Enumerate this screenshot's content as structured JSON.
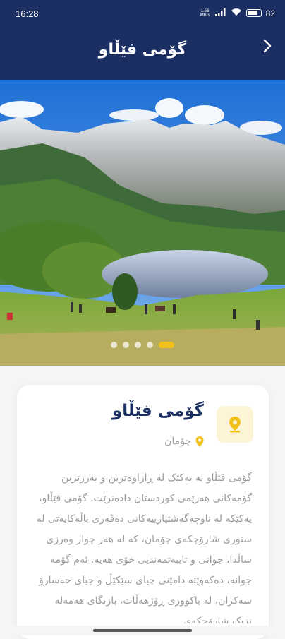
{
  "status_bar": {
    "time": "16:28",
    "network_speed": "1.56\nMB/s",
    "battery": "82"
  },
  "header": {
    "title": "گۆمی فێڵاو",
    "back_icon": "chevron-right-icon"
  },
  "carousel": {
    "slide_count": 5,
    "active_index": 4
  },
  "place": {
    "name": "گۆمی فێڵاو",
    "location": "چۆمان",
    "description": "گۆمی فێڵاو بە یەکێک لە ڕازاوەترین و بەرزترین گۆمەکانی هەرێمی کوردستان دادەنرێت. گۆمی فێڵاو، یەکێکە لە ناوچەگەشتیارییەکانی دەڤەری باڵەکایەتی لە سنوری شارۆچکەی چۆمان، کە لە هەر چوار وەرزی ساڵدا، جوانی و تایبەتمەندیی خۆی هەیە. ئەم گۆمە جوانە، دەکەوێتە دامێنی چیای سێکێڵ و چیای حەسارۆ سەکران، لە باکووری ڕۆژهەڵات، بازنگای هەمەلە نزیک شارۆچکەی",
    "accent_color": "#f2c21a",
    "title_color": "#1b2f63"
  }
}
